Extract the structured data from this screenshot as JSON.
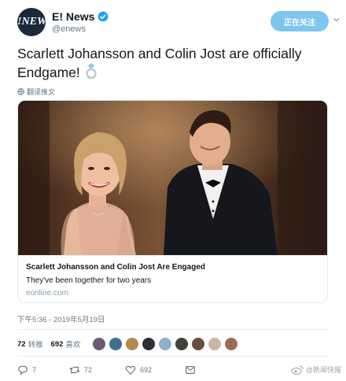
{
  "account": {
    "avatar_text": "E!NEWS",
    "display_name": "E! News",
    "handle": "@enews",
    "follow_label": "正在关注"
  },
  "tweet": {
    "text": "Scarlett Johansson and Colin Jost are officially Endgame!",
    "translate_label": "翻译推文",
    "timestamp": "下午5:36 - 2019年5月19日"
  },
  "card": {
    "title": "Scarlett Johansson and Colin Jost Are Engaged",
    "description": "They've been together for two years",
    "domain": "eonline.com"
  },
  "stats": {
    "retweets_count": "72",
    "retweets_label": "转推",
    "likes_count": "692",
    "likes_label": "喜欢"
  },
  "actions": {
    "reply_count": "7",
    "retweet_count": "72",
    "like_count": "692"
  },
  "watermark": "@新闻快报",
  "colors": {
    "follow_bg": "#7ec6ee",
    "verified": "#1da1f2",
    "muted": "#657786"
  },
  "icons": [
    "verified-badge-icon",
    "chevron-down-icon",
    "ring-emoji-icon",
    "globe-icon",
    "reply-icon",
    "retweet-icon",
    "heart-icon",
    "dm-icon"
  ]
}
